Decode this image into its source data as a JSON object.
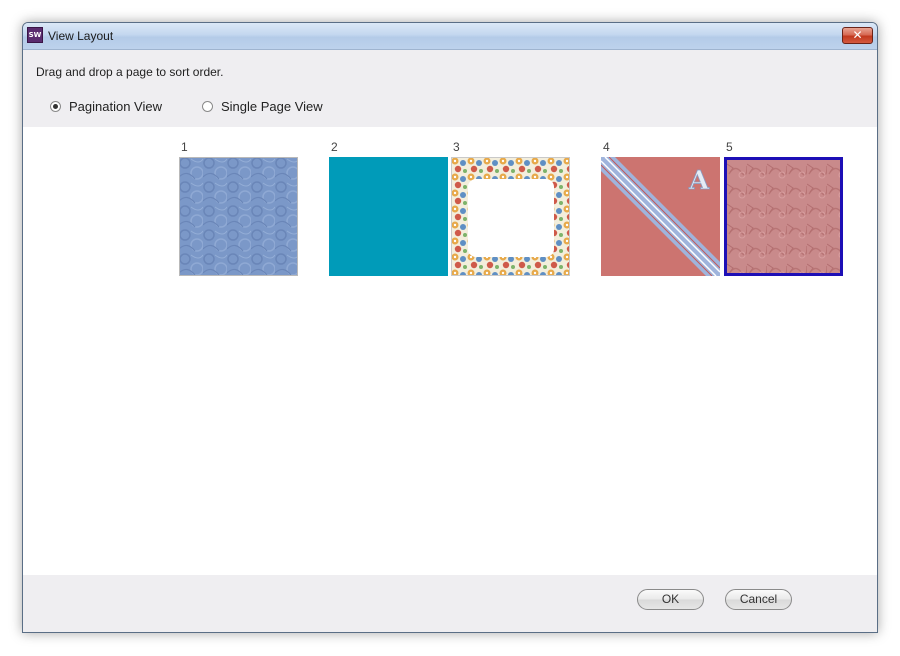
{
  "window": {
    "title": "View Layout",
    "icon_label": "SW",
    "close_glyph": "✕"
  },
  "instruction": "Drag and drop a page to sort order.",
  "view_modes": {
    "selected": "Pagination View",
    "options": [
      "Pagination View",
      "Single Page View"
    ]
  },
  "pages": [
    {
      "number": "1",
      "icon": "blue-pattern-thumbnail",
      "colors": {
        "base": "#7b98c8"
      }
    },
    {
      "number": "2",
      "icon": "teal-solid-thumbnail",
      "colors": {
        "base": "#009bb9"
      }
    },
    {
      "number": "3",
      "icon": "floral-frame-thumbnail",
      "colors": {
        "base": "#ffffff"
      }
    },
    {
      "number": "4",
      "icon": "red-diagonal-stripe-thumbnail",
      "colors": {
        "base": "#cc7470",
        "stripe": "#9fb4dc"
      },
      "letter": "A"
    },
    {
      "number": "5",
      "icon": "rose-pattern-thumbnail",
      "colors": {
        "base": "#c98a8b",
        "border": "#1d0fb6"
      },
      "selected": true
    }
  ],
  "buttons": {
    "ok": "OK",
    "cancel": "Cancel"
  }
}
